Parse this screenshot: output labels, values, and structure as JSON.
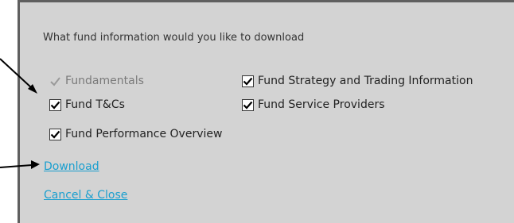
{
  "dialog": {
    "question": "What fund information would you like to download",
    "options": [
      {
        "label": "Fundamentals",
        "checked": true,
        "disabled": true
      },
      {
        "label": "Fund Strategy and Trading Information",
        "checked": true,
        "disabled": false
      },
      {
        "label": "Fund T&Cs",
        "checked": true,
        "disabled": false
      },
      {
        "label": "Fund Service Providers",
        "checked": true,
        "disabled": false
      },
      {
        "label": "Fund Performance Overview",
        "checked": true,
        "disabled": false
      }
    ],
    "download_label": "Download",
    "cancel_label": "Cancel & Close"
  },
  "colors": {
    "panel_background": "#d3d3d3",
    "link": "#1a9fcf",
    "annotation_arrow": "#000000"
  }
}
